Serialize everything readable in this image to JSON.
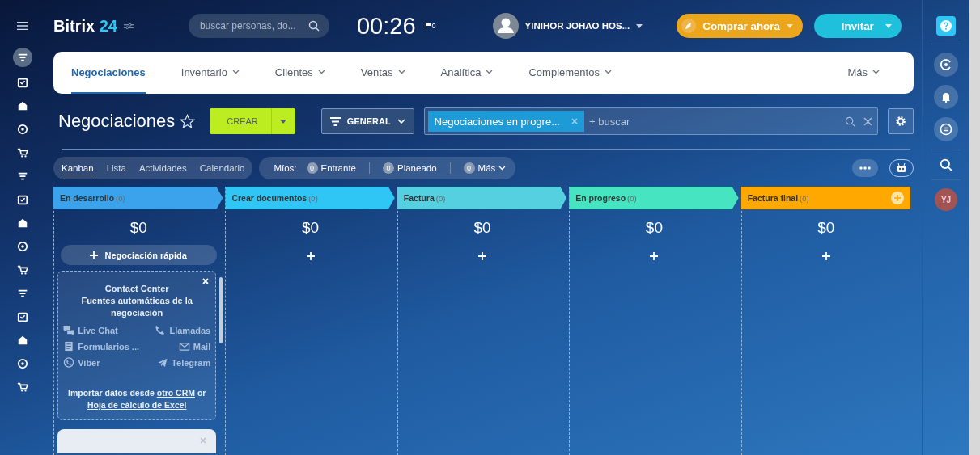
{
  "header": {
    "logo": {
      "name": "Bitrix",
      "number": "24"
    },
    "search": {
      "placeholder": "buscar personas, do..."
    },
    "clock": "00:26",
    "flag_count": "0",
    "user_name": "YINIHOR JOHAO HOS...",
    "buy_button": "Comprar ahora",
    "invite_button": "Invitar"
  },
  "left_sidebar": [
    {
      "selected": true
    },
    {
      "selected": false
    },
    {
      "selected": false
    },
    {
      "selected": false
    },
    {
      "selected": false
    },
    {
      "selected": false
    },
    {
      "selected": false
    },
    {
      "selected": false
    },
    {
      "selected": false
    },
    {
      "selected": false
    },
    {
      "selected": false
    },
    {
      "selected": false
    },
    {
      "selected": false
    },
    {
      "selected": false
    },
    {
      "selected": false
    }
  ],
  "nav_tabs": [
    {
      "label": "Negociaciones",
      "selected": true,
      "dropdown": false
    },
    {
      "label": "Inventario",
      "selected": false,
      "dropdown": true
    },
    {
      "label": "Clientes",
      "selected": false,
      "dropdown": true
    },
    {
      "label": "Ventas",
      "selected": false,
      "dropdown": true
    },
    {
      "label": "Analítica",
      "selected": false,
      "dropdown": true
    },
    {
      "label": "Complementos",
      "selected": false,
      "dropdown": true
    },
    {
      "label": "Más",
      "selected": false,
      "dropdown": true
    }
  ],
  "toolbar": {
    "title": "Negociaciones",
    "create_button": "CREAR",
    "filter_button": "GENERAL",
    "filter_chip": "Negociaciones en progre...",
    "search_placeholder": "+ buscar"
  },
  "views": [
    {
      "label": "Kanban",
      "selected": true
    },
    {
      "label": "Lista",
      "selected": false
    },
    {
      "label": "Actividades",
      "selected": false
    },
    {
      "label": "Calendario",
      "selected": false
    }
  ],
  "mine": {
    "label": "Míos:",
    "counters": [
      {
        "count": "0",
        "label": "Entrante",
        "dropdown": false
      },
      {
        "count": "0",
        "label": "Planeado",
        "dropdown": false
      },
      {
        "count": "0",
        "label": "Más",
        "dropdown": true
      }
    ]
  },
  "stages": [
    {
      "name": "En desarrollo",
      "count": "(0)",
      "color": "#3ba3ec",
      "amount": "$0"
    },
    {
      "name": "Crear documentos",
      "count": "(0)",
      "color": "#2fc6f6",
      "amount": "$0"
    },
    {
      "name": "Factura",
      "count": "(0)",
      "color": "#55d0e0",
      "amount": "$0"
    },
    {
      "name": "En progreso",
      "count": "(0)",
      "color": "#47e4c2",
      "amount": "$0"
    },
    {
      "name": "Factura final",
      "count": "(0)",
      "color": "#ffa900",
      "amount": "$0"
    }
  ],
  "quick_deal_button": "Negociación rápida",
  "contact_card": {
    "title": "Contact Center",
    "subtitle": "Fuentes automáticas de la negociación",
    "channels": [
      {
        "kind": "chat",
        "label": "Live Chat"
      },
      {
        "kind": "phone",
        "label": "Llamadas"
      },
      {
        "kind": "form",
        "label": "Formularios ..."
      },
      {
        "kind": "mail",
        "label": "Mail"
      },
      {
        "kind": "viber",
        "label": "Viber"
      },
      {
        "kind": "telegram",
        "label": "Telegram"
      }
    ],
    "import_text": [
      "Importar datos desde ",
      "otro CRM",
      " or ",
      "Hoja de cálculo de Excel"
    ]
  },
  "right_sidebar": {
    "avatar_initials": "YJ"
  }
}
